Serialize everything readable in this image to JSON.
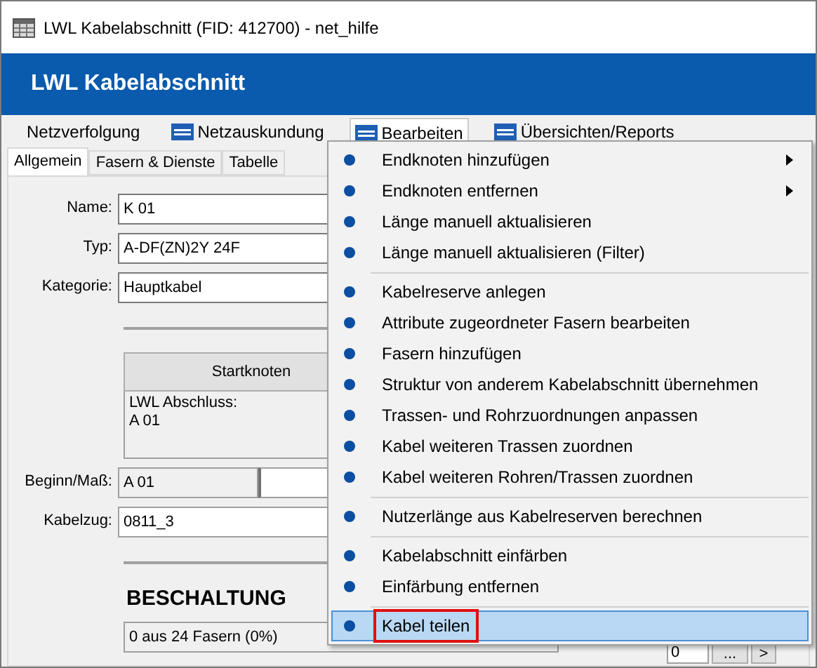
{
  "window": {
    "title": "LWL Kabelabschnitt (FID: 412700) - net_hilfe"
  },
  "header": {
    "title": "LWL Kabelabschnitt"
  },
  "menubar": [
    {
      "label": "Netzverfolgung",
      "net_icon": false,
      "selected": false
    },
    {
      "label": "Netzauskundung",
      "net_icon": true,
      "selected": false
    },
    {
      "label": "Bearbeiten",
      "net_icon": true,
      "selected": true
    },
    {
      "label": "Übersichten/Reports",
      "net_icon": true,
      "selected": false
    }
  ],
  "tabs": [
    {
      "label": "Allgemein",
      "selected": true
    },
    {
      "label": "Fasern & Dienste",
      "selected": false
    },
    {
      "label": "Tabelle",
      "selected": false
    }
  ],
  "form": {
    "name": {
      "label": "Name:",
      "value": "K 01"
    },
    "typ": {
      "label": "Typ:",
      "value": "A-DF(ZN)2Y 24F"
    },
    "kategorie": {
      "label": "Kategorie:",
      "value": "Hauptkabel"
    },
    "start_button": "Startknoten",
    "start_info": [
      "LWL Abschluss:",
      "A 01"
    ],
    "beginn": {
      "label": "Beginn/Maß:",
      "value": "A 01"
    },
    "kabelzug": {
      "label": "Kabelzug:",
      "value": "0811_3"
    },
    "section_title": "BESCHALTUNG",
    "fiber_status": "0 aus 24 Fasern (0%)",
    "dienste_value": "0",
    "more_button": "...",
    "next_button": ">"
  },
  "context_menu": [
    {
      "kind": "item",
      "label": "Endknoten hinzufügen",
      "submenu": true,
      "selected": false,
      "marked": false
    },
    {
      "kind": "item",
      "label": "Endknoten entfernen",
      "submenu": true,
      "selected": false,
      "marked": false
    },
    {
      "kind": "item",
      "label": "Länge manuell aktualisieren",
      "submenu": false,
      "selected": false,
      "marked": false
    },
    {
      "kind": "item",
      "label": "Länge manuell aktualisieren (Filter)",
      "submenu": false,
      "selected": false,
      "marked": false
    },
    {
      "kind": "separator"
    },
    {
      "kind": "item",
      "label": "Kabelreserve anlegen",
      "submenu": false,
      "selected": false,
      "marked": false
    },
    {
      "kind": "item",
      "label": "Attribute zugeordneter Fasern bearbeiten",
      "submenu": false,
      "selected": false,
      "marked": false
    },
    {
      "kind": "item",
      "label": "Fasern hinzufügen",
      "submenu": false,
      "selected": false,
      "marked": false
    },
    {
      "kind": "item",
      "label": "Struktur von anderem Kabelabschnitt übernehmen",
      "submenu": false,
      "selected": false,
      "marked": false
    },
    {
      "kind": "item",
      "label": "Trassen- und Rohrzuordnungen anpassen",
      "submenu": false,
      "selected": false,
      "marked": false
    },
    {
      "kind": "item",
      "label": "Kabel weiteren Trassen zuordnen",
      "submenu": false,
      "selected": false,
      "marked": false
    },
    {
      "kind": "item",
      "label": "Kabel weiteren Rohren/Trassen zuordnen",
      "submenu": false,
      "selected": false,
      "marked": false
    },
    {
      "kind": "separator"
    },
    {
      "kind": "item",
      "label": "Nutzerlänge aus Kabelreserven berechnen",
      "submenu": false,
      "selected": false,
      "marked": false
    },
    {
      "kind": "separator"
    },
    {
      "kind": "item",
      "label": "Kabelabschnitt einfärben",
      "submenu": false,
      "selected": false,
      "marked": false
    },
    {
      "kind": "item",
      "label": "Einfärbung entfernen",
      "submenu": false,
      "selected": false,
      "marked": false
    },
    {
      "kind": "separator"
    },
    {
      "kind": "item",
      "label": "Kabel teilen",
      "submenu": false,
      "selected": true,
      "marked": true
    }
  ]
}
